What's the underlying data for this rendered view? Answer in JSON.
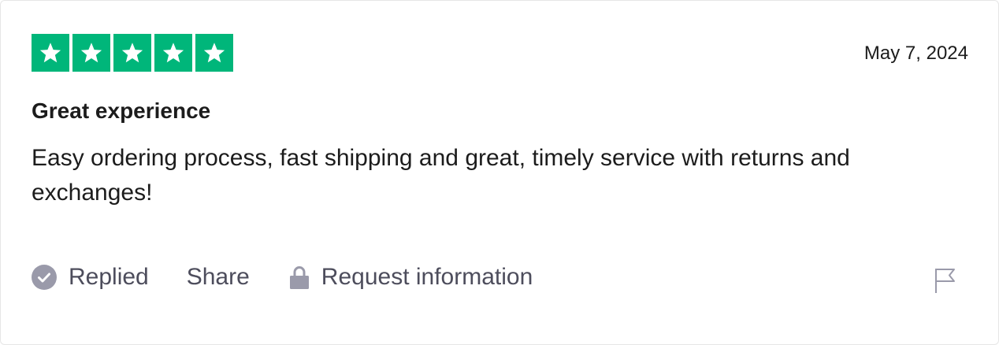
{
  "review": {
    "rating": 5,
    "rating_max": 5,
    "star_color": "#00b67a",
    "date": "May 7, 2024",
    "title": "Great experience",
    "body": "Easy ordering process, fast shipping and great, timely service with returns and exchanges!"
  },
  "actions": {
    "replied_label": "Replied",
    "replied_icon": "check-circle-icon",
    "share_label": "Share",
    "request_label": "Request information",
    "request_icon": "lock-icon",
    "flag_icon": "flag-icon",
    "icon_color": "#9a9aaa"
  }
}
